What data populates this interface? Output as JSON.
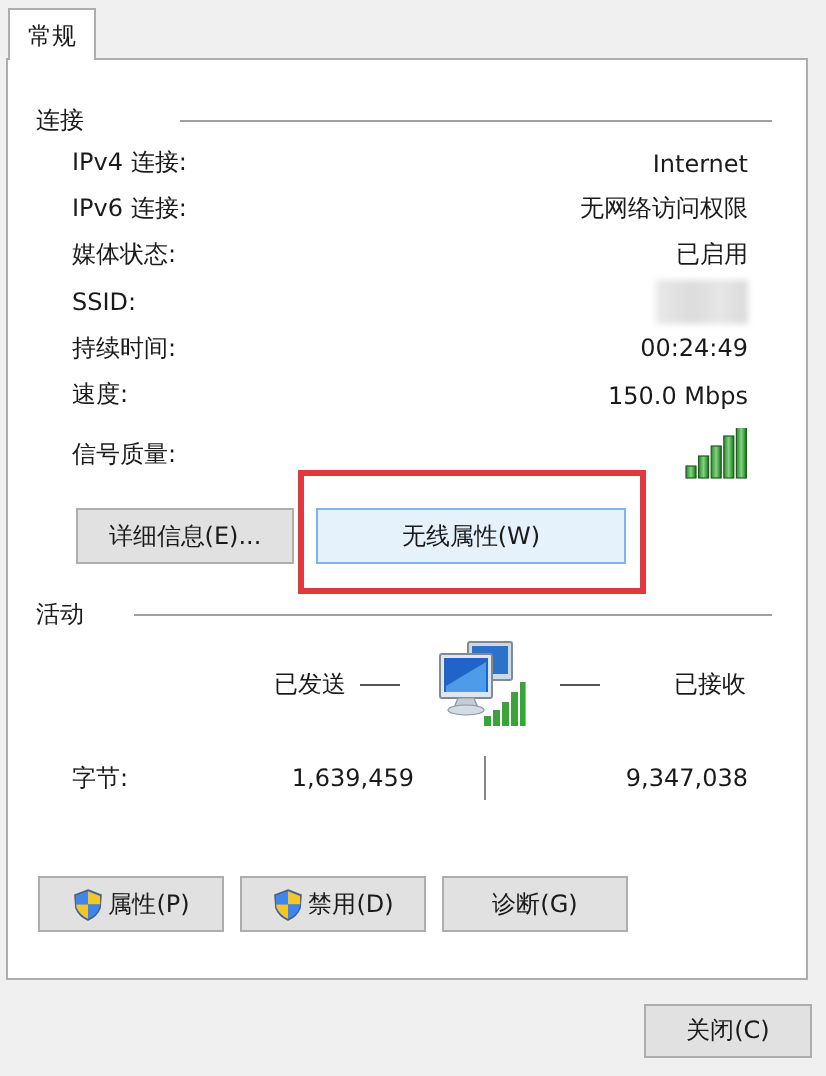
{
  "tabs": [
    {
      "label": "常规",
      "selected": true
    }
  ],
  "connection": {
    "title": "连接",
    "rows": [
      {
        "label": "IPv4 连接:",
        "value": "Internet",
        "kind": "text"
      },
      {
        "label": "IPv6 连接:",
        "value": "无网络访问权限",
        "kind": "text"
      },
      {
        "label": "媒体状态:",
        "value": "已启用",
        "kind": "text"
      },
      {
        "label": "SSID:",
        "kind": "redacted"
      },
      {
        "label": "持续时间:",
        "value": "00:24:49",
        "kind": "text"
      },
      {
        "label": "速度:",
        "value": "150.0 Mbps",
        "kind": "text"
      },
      {
        "label": "信号质量:",
        "kind": "signal"
      }
    ]
  },
  "connection_buttons": [
    {
      "label": "详细信息(E)...",
      "focused": false,
      "highlighted": false
    },
    {
      "label": "无线属性(W)",
      "focused": true,
      "highlighted": true
    }
  ],
  "activity": {
    "title": "活动",
    "sent_label": "已发送",
    "received_label": "已接收",
    "bytes_label": "字节:",
    "bytes_sent": "1,639,459",
    "bytes_received": "9,347,038"
  },
  "action_buttons": [
    {
      "label": "属性(P)",
      "shield": true
    },
    {
      "label": "禁用(D)",
      "shield": true
    },
    {
      "label": "诊断(G)",
      "shield": false
    }
  ],
  "close_button": {
    "label": "关闭(C)"
  }
}
